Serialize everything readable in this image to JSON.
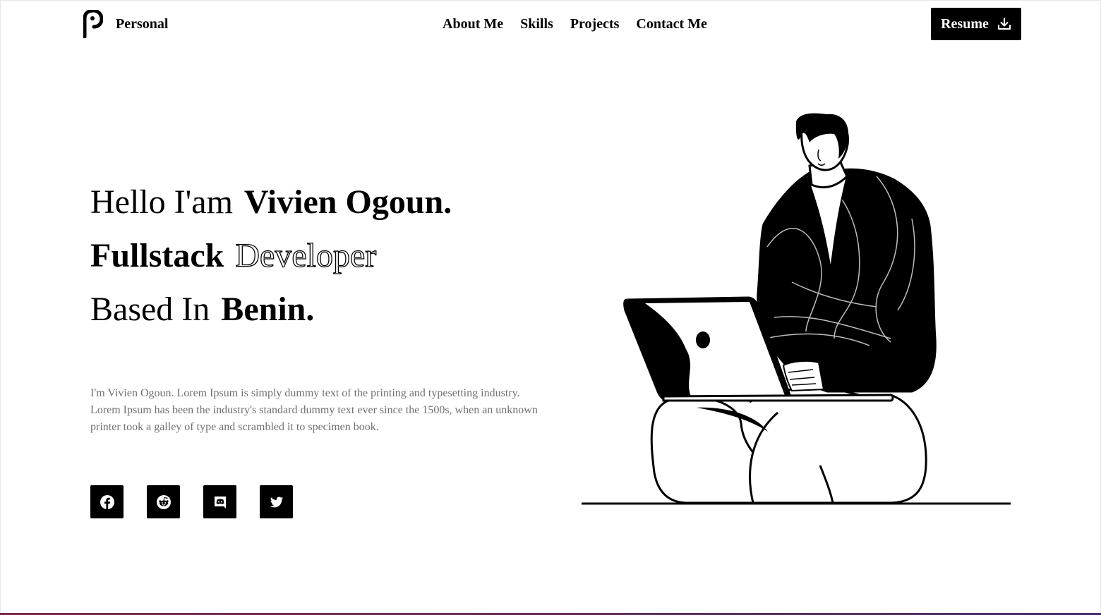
{
  "header": {
    "logo_text": "Personal",
    "nav": [
      "About Me",
      "Skills",
      "Projects",
      "Contact Me"
    ],
    "resume_label": "Resume"
  },
  "hero": {
    "line1_light": "Hello I'am",
    "line1_bold": "Vivien Ogoun.",
    "line2_bold": "Fullstack",
    "line2_outline": "Developer",
    "line3_light": "Based In",
    "line3_bold": "Benin.",
    "description": "I'm Vivien Ogoun. Lorem Ipsum is simply dummy text of the printing and typesetting industry. Lorem Ipsum has been the industry's standard dummy text ever since the 1500s, when an unknown printer took a galley of type and scrambled it to specimen book."
  },
  "socials": [
    {
      "icon": "facebook-icon"
    },
    {
      "icon": "reddit-icon"
    },
    {
      "icon": "discord-icon"
    },
    {
      "icon": "twitter-icon"
    }
  ],
  "colors": {
    "primary": "#000000",
    "background": "#ffffff",
    "body_text": "#6f7071",
    "accent_bar": "#6b2d5c"
  }
}
